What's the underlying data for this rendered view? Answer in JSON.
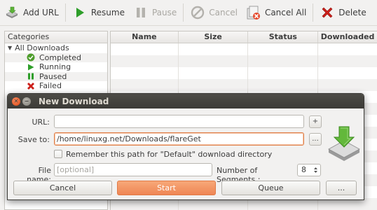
{
  "toolbar": {
    "add_url": "Add URL",
    "resume": "Resume",
    "pause": "Pause",
    "cancel": "Cancel",
    "cancel_all": "Cancel All",
    "delete": "Delete"
  },
  "categories": {
    "header": "Categories",
    "root": "All Downloads",
    "items": [
      {
        "label": "Completed",
        "icon": "completed-icon"
      },
      {
        "label": "Running",
        "icon": "running-icon"
      },
      {
        "label": "Paused",
        "icon": "paused-icon"
      },
      {
        "label": "Failed",
        "icon": "failed-icon"
      }
    ]
  },
  "table": {
    "columns": [
      "Name",
      "Size",
      "Status",
      "Downloaded"
    ]
  },
  "dialog": {
    "title": "New Download",
    "url_label": "URL:",
    "url_value": "",
    "save_label": "Save to:",
    "save_value": "/home/linuxg.net/Downloads/flareGet",
    "remember_label": "Remember this path for \"Default\" download directory",
    "remember_checked": false,
    "filename_label": "File name:",
    "filename_placeholder": "[optional]",
    "segments_label": "Number of Segments :",
    "segments_value": "8",
    "add_button": "+",
    "browse_button": "...",
    "cancel_button": "Cancel",
    "start_button": "Start",
    "queue_button": "Queue",
    "more_button": "..."
  },
  "colors": {
    "accent_orange": "#ef8655",
    "titlebar": "#3c3b37",
    "play_green": "#2e9e2a",
    "delete_red": "#cc1f1a"
  }
}
